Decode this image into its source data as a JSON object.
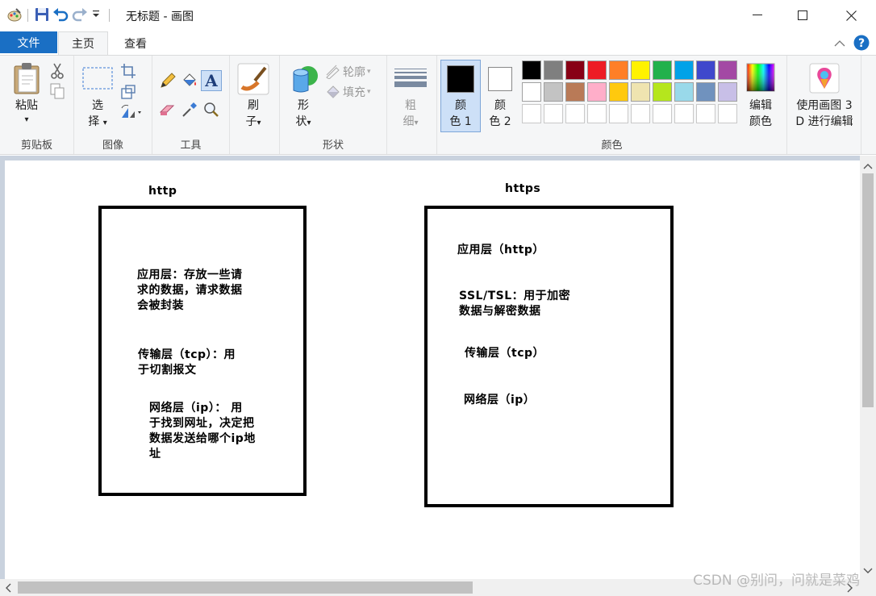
{
  "window": {
    "title": "无标题 - 画图"
  },
  "tabs": {
    "file": "文件",
    "home": "主页",
    "view": "查看"
  },
  "ribbon": {
    "clipboard": {
      "label": "剪贴板",
      "paste": "粘贴"
    },
    "image": {
      "label": "图像",
      "select_1": "选",
      "select_2": "择"
    },
    "tools": {
      "label": "工具",
      "text_icon": "A"
    },
    "brushes": {
      "label_1": "刷",
      "label_2": "子"
    },
    "shapes": {
      "label": "形状",
      "shapes_1": "形",
      "shapes_2": "状",
      "outline": "轮廓",
      "fill": "填充"
    },
    "size": {
      "label_1": "粗",
      "label_2": "细"
    },
    "colors": {
      "label": "颜色",
      "color1_1": "颜",
      "color1_2": "色 1",
      "color2_1": "颜",
      "color2_2": "色 2",
      "edit_1": "编辑",
      "edit_2": "颜色",
      "color1_value": "#000000",
      "color2_value": "#ffffff",
      "palette_row1": [
        "#000000",
        "#7f7f7f",
        "#880015",
        "#ed1c24",
        "#ff7f27",
        "#fff200",
        "#22b14c",
        "#00a2e8",
        "#3f48cc",
        "#a349a4"
      ],
      "palette_row2": [
        "#ffffff",
        "#c3c3c3",
        "#b97a57",
        "#ffaec9",
        "#ffc90e",
        "#efe4b0",
        "#b5e61d",
        "#99d9ea",
        "#7092be",
        "#c8bfe7"
      ]
    },
    "paint3d": {
      "line1": "使用画图 3",
      "line2": "D 进行编辑"
    }
  },
  "canvas": {
    "http": {
      "title": "http",
      "app_line1": "应用层：存放一些请",
      "app_line2": "求的数据，请求数据",
      "app_line3": "会被封装",
      "tcp_line1": "传输层（tcp）：用",
      "tcp_line2": "于切割报文",
      "ip_line1": "网络层（ip）： 用",
      "ip_line2": "于找到网址，决定把",
      "ip_line3": "数据发送给哪个ip地",
      "ip_line4": "址"
    },
    "https": {
      "title": "https",
      "app": "应用层（http）",
      "ssl_line1": "SSL/TSL：用于加密",
      "ssl_line2": "数据与解密数据",
      "tcp": "传输层（tcp）",
      "ip": "网络层（ip）"
    }
  },
  "watermark": "CSDN @别问，问就是菜鸡"
}
